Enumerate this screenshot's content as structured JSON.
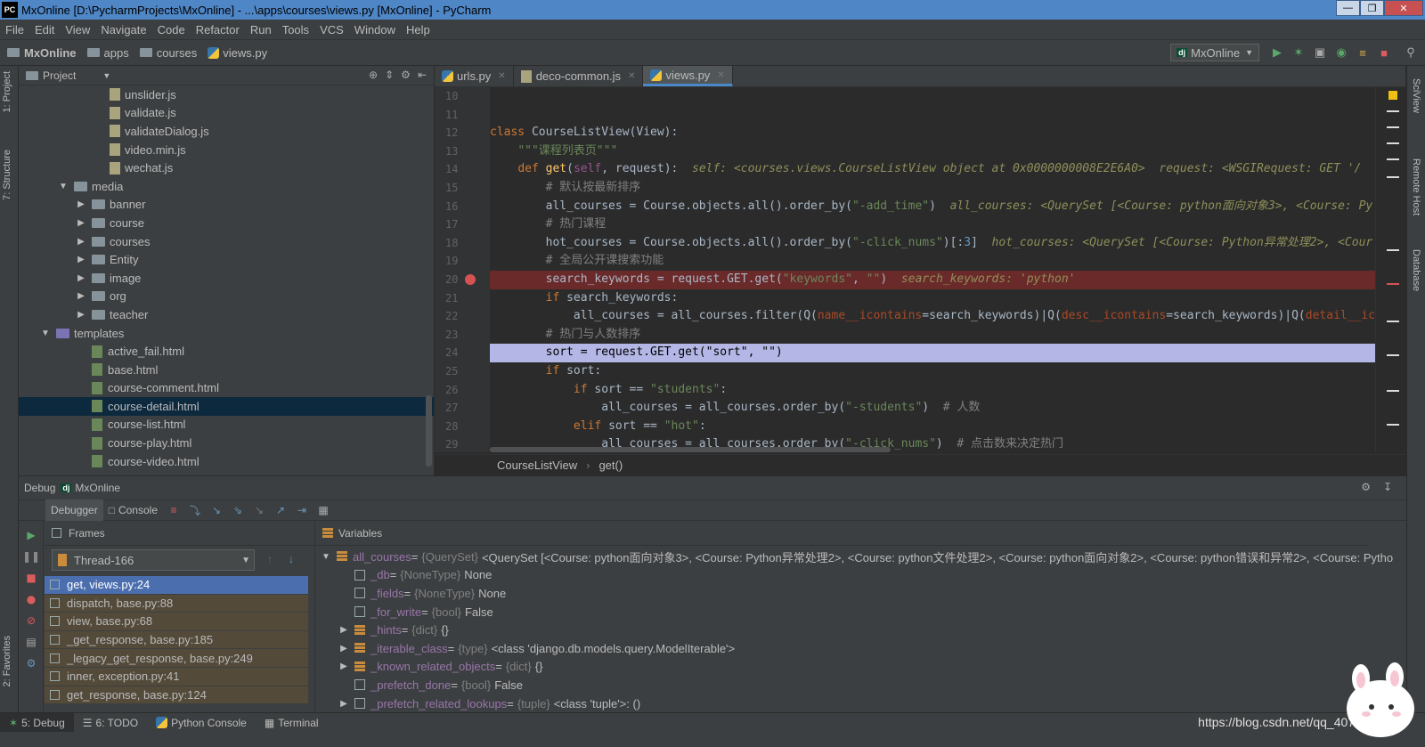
{
  "window": {
    "title": "MxOnline [D:\\PycharmProjects\\MxOnline] - ...\\apps\\courses\\views.py [MxOnline] - PyCharm",
    "logo": "PC"
  },
  "menu": [
    "File",
    "Edit",
    "View",
    "Navigate",
    "Code",
    "Refactor",
    "Run",
    "Tools",
    "VCS",
    "Window",
    "Help"
  ],
  "nav": {
    "breadcrumbs": [
      "MxOnline",
      "apps",
      "courses",
      "views.py"
    ],
    "run_config": "MxOnline",
    "run_config_badge": "dj"
  },
  "left_strip": {
    "project": "1: Project",
    "structure": "7: Structure",
    "favorites": "2: Favorites"
  },
  "right_strip": {
    "sciview": "SciView",
    "remote_host": "Remote Host",
    "database": "Database"
  },
  "project": {
    "header": "Project",
    "tree": [
      {
        "label": "unslider.js",
        "type": "js",
        "indent": 4
      },
      {
        "label": "validate.js",
        "type": "js",
        "indent": 4
      },
      {
        "label": "validateDialog.js",
        "type": "js",
        "indent": 4
      },
      {
        "label": "video.min.js",
        "type": "js",
        "indent": 4
      },
      {
        "label": "wechat.js",
        "type": "js",
        "indent": 4
      },
      {
        "label": "media",
        "type": "folder-open",
        "indent": 2
      },
      {
        "label": "banner",
        "type": "folder",
        "indent": 3
      },
      {
        "label": "course",
        "type": "folder",
        "indent": 3
      },
      {
        "label": "courses",
        "type": "folder",
        "indent": 3
      },
      {
        "label": "Entity",
        "type": "folder",
        "indent": 3
      },
      {
        "label": "image",
        "type": "folder",
        "indent": 3
      },
      {
        "label": "org",
        "type": "folder",
        "indent": 3
      },
      {
        "label": "teacher",
        "type": "folder",
        "indent": 3
      },
      {
        "label": "templates",
        "type": "tpl-open",
        "indent": 1
      },
      {
        "label": "active_fail.html",
        "type": "html",
        "indent": 3
      },
      {
        "label": "base.html",
        "type": "html",
        "indent": 3
      },
      {
        "label": "course-comment.html",
        "type": "html",
        "indent": 3
      },
      {
        "label": "course-detail.html",
        "type": "html",
        "indent": 3,
        "selected": true
      },
      {
        "label": "course-list.html",
        "type": "html",
        "indent": 3
      },
      {
        "label": "course-play.html",
        "type": "html",
        "indent": 3
      },
      {
        "label": "course-video.html",
        "type": "html",
        "indent": 3
      }
    ]
  },
  "editor": {
    "tabs": [
      {
        "label": "urls.py",
        "active": false
      },
      {
        "label": "deco-common.js",
        "active": false
      },
      {
        "label": "views.py",
        "active": true
      }
    ],
    "line_numbers": [
      "10",
      "11",
      "12",
      "13",
      "14",
      "15",
      "16",
      "17",
      "18",
      "19",
      "20",
      "21",
      "22",
      "23",
      "24",
      "25",
      "26",
      "27",
      "28",
      "29"
    ],
    "breakpoint_line": "20",
    "current_line": "24",
    "code_breadcrumb": [
      "CourseListView",
      "get()"
    ]
  },
  "debug": {
    "title": "Debug",
    "config": "MxOnline",
    "tabs": [
      "Debugger",
      "Console"
    ],
    "frames_header": "Frames",
    "variables_header": "Variables",
    "thread": "Thread-166",
    "frames": [
      {
        "label": "get, views.py:24",
        "selected": true
      },
      {
        "label": "dispatch, base.py:88"
      },
      {
        "label": "view, base.py:68"
      },
      {
        "label": "_get_response, base.py:185"
      },
      {
        "label": "_legacy_get_response, base.py:249"
      },
      {
        "label": "inner, exception.py:41"
      },
      {
        "label": "get_response, base.py:124"
      }
    ],
    "variables": [
      {
        "name": "all_courses",
        "type": "{QuerySet}",
        "value": "<QuerySet [<Course: python面向对象3>, <Course: Python异常处理2>, <Course: python文件处理2>, <Course: python面向对象2>, <Course: python错误和异常2>, <Course: Pytho",
        "expandable": true,
        "expanded": true,
        "indent": 0,
        "icon": "obj"
      },
      {
        "name": "_db",
        "type": "{NoneType}",
        "value": "None",
        "indent": 1,
        "icon": "fld"
      },
      {
        "name": "_fields",
        "type": "{NoneType}",
        "value": "None",
        "indent": 1,
        "icon": "fld"
      },
      {
        "name": "_for_write",
        "type": "{bool}",
        "value": "False",
        "indent": 1,
        "icon": "fld"
      },
      {
        "name": "_hints",
        "type": "{dict}",
        "value": "{}",
        "expandable": true,
        "indent": 1,
        "icon": "obj"
      },
      {
        "name": "_iterable_class",
        "type": "{type}",
        "value": "<class 'django.db.models.query.ModelIterable'>",
        "expandable": true,
        "indent": 1,
        "icon": "obj"
      },
      {
        "name": "_known_related_objects",
        "type": "{dict}",
        "value": "{}",
        "expandable": true,
        "indent": 1,
        "icon": "obj"
      },
      {
        "name": "_prefetch_done",
        "type": "{bool}",
        "value": "False",
        "indent": 1,
        "icon": "fld"
      },
      {
        "name": "_prefetch_related_lookups",
        "type": "{tuple}",
        "value": "<class 'tuple'>: ()",
        "expandable": true,
        "indent": 1,
        "icon": "fld"
      }
    ]
  },
  "statusbar": {
    "tabs": [
      "5: Debug",
      "6: TODO",
      "Python Console",
      "Terminal"
    ],
    "watermark": "https://blog.csdn.net/qq_40762429"
  }
}
